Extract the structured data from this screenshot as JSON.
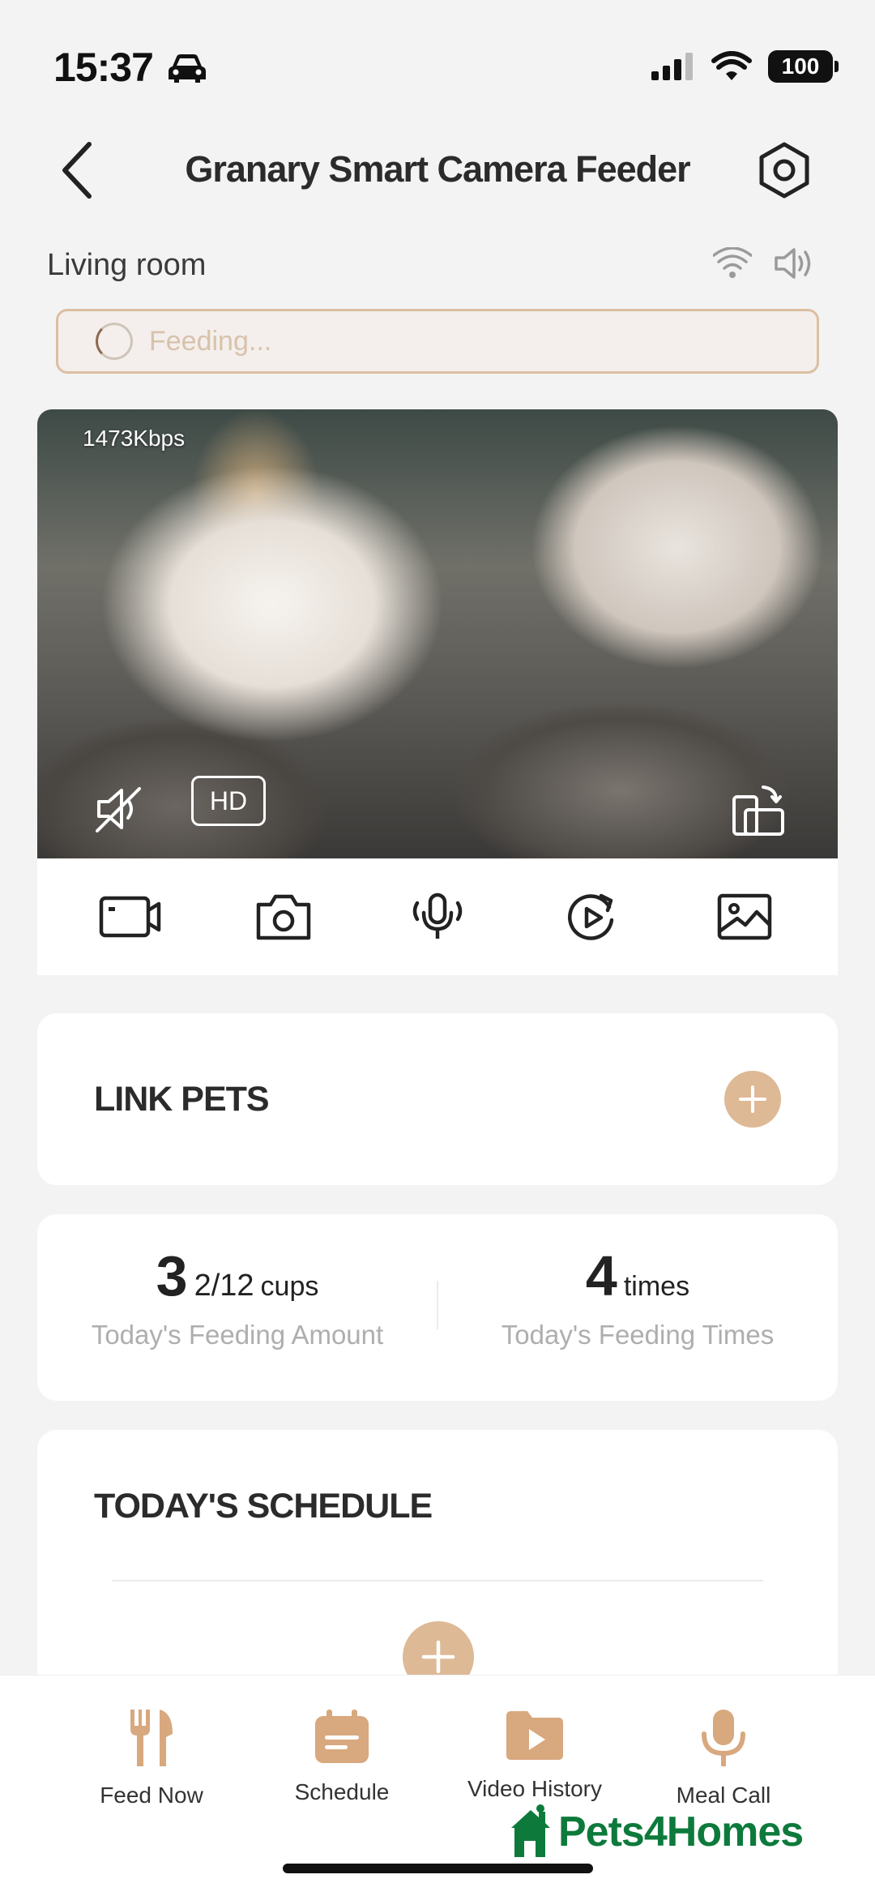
{
  "status_bar": {
    "time": "15:37",
    "battery": "100"
  },
  "header": {
    "title": "Granary Smart Camera Feeder"
  },
  "device": {
    "location": "Living room",
    "feeding_status": "Feeding..."
  },
  "video": {
    "bitrate": "1473Kbps",
    "quality_label": "HD"
  },
  "link_pets": {
    "title": "LINK PETS"
  },
  "stats": {
    "amount_whole": "3",
    "amount_fraction": "2/12",
    "amount_unit": "cups",
    "amount_label": "Today's Feeding Amount",
    "times_value": "4",
    "times_unit": "times",
    "times_label": "Today's Feeding Times"
  },
  "schedule": {
    "title": "TODAY'S SCHEDULE"
  },
  "bottom_nav": {
    "items": [
      {
        "label": "Feed Now",
        "icon": "fork-knife-icon"
      },
      {
        "label": "Schedule",
        "icon": "calendar-icon"
      },
      {
        "label": "Video History",
        "icon": "video-folder-icon"
      },
      {
        "label": "Meal Call",
        "icon": "microphone-icon"
      }
    ]
  },
  "watermark": {
    "text": "Pets4Homes"
  },
  "colors": {
    "accent": "#deb996",
    "accent_dark": "#d8a87e",
    "background": "#f3f3f3",
    "watermark": "#0d7a3c"
  }
}
